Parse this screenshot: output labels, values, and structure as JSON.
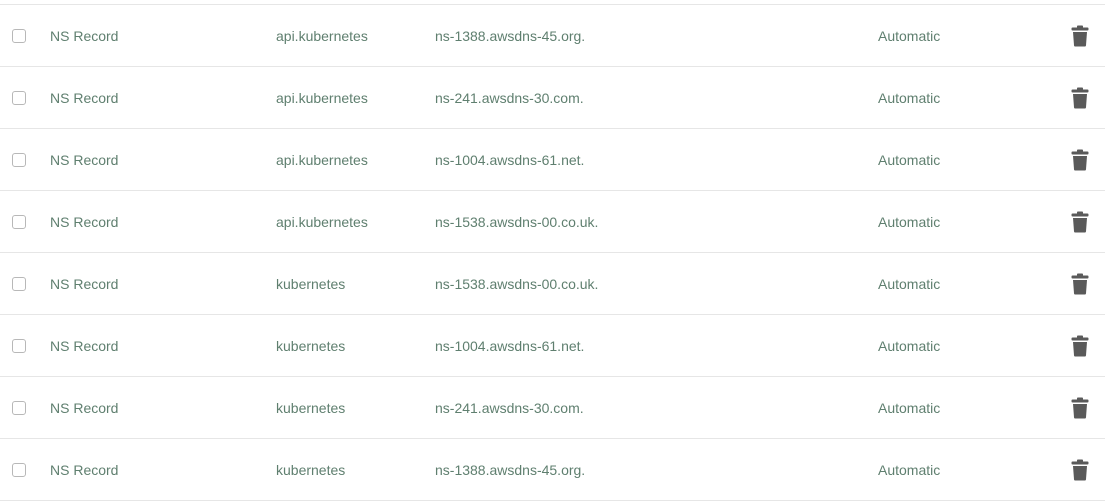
{
  "records": [
    {
      "type": "NS Record",
      "name": "api.kubernetes",
      "value": "ns-1388.awsdns-45.org.",
      "ttl": "Automatic"
    },
    {
      "type": "NS Record",
      "name": "api.kubernetes",
      "value": "ns-241.awsdns-30.com.",
      "ttl": "Automatic"
    },
    {
      "type": "NS Record",
      "name": "api.kubernetes",
      "value": "ns-1004.awsdns-61.net.",
      "ttl": "Automatic"
    },
    {
      "type": "NS Record",
      "name": "api.kubernetes",
      "value": "ns-1538.awsdns-00.co.uk.",
      "ttl": "Automatic"
    },
    {
      "type": "NS Record",
      "name": "kubernetes",
      "value": "ns-1538.awsdns-00.co.uk.",
      "ttl": "Automatic"
    },
    {
      "type": "NS Record",
      "name": "kubernetes",
      "value": "ns-1004.awsdns-61.net.",
      "ttl": "Automatic"
    },
    {
      "type": "NS Record",
      "name": "kubernetes",
      "value": "ns-241.awsdns-30.com.",
      "ttl": "Automatic"
    },
    {
      "type": "NS Record",
      "name": "kubernetes",
      "value": "ns-1388.awsdns-45.org.",
      "ttl": "Automatic"
    }
  ],
  "icons": {
    "row_checkbox": "checkbox-icon",
    "delete": "trash-icon"
  },
  "colors": {
    "text": "#5f7f6f",
    "icon": "#5a5a5a",
    "divider": "#e6e6e6"
  }
}
